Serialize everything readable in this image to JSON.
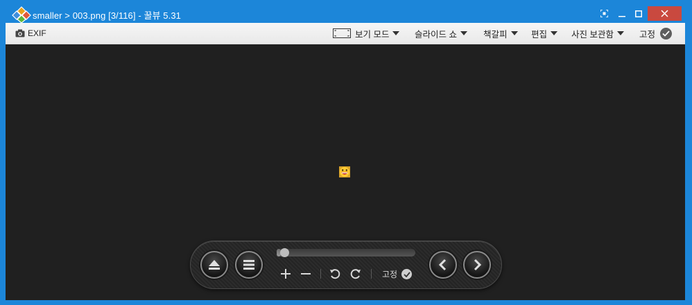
{
  "window": {
    "title": "smaller > 003.png [3/116] - 꿀뷰 5.31",
    "colors": {
      "titlebar": "#1c86d9",
      "close": "#c9493f",
      "viewer_bg": "#202020"
    }
  },
  "toolbar": {
    "exif_label": "EXIF",
    "view_mode_label": "보기 모드",
    "slideshow_label": "슬라이드 쇼",
    "bookmark_label": "책갈피",
    "edit_label": "편집",
    "photo_storage_label": "사진 보관함",
    "pin_label": "고정"
  },
  "viewer": {
    "image_icon": "grinning-face-emoji"
  },
  "controls": {
    "progress": 0.03,
    "pin_label": "고정",
    "icons": [
      "eject-icon",
      "menu-icon",
      "zoom-in-icon",
      "zoom-out-icon",
      "rotate-left-icon",
      "rotate-right-icon",
      "prev-icon",
      "next-icon"
    ]
  }
}
